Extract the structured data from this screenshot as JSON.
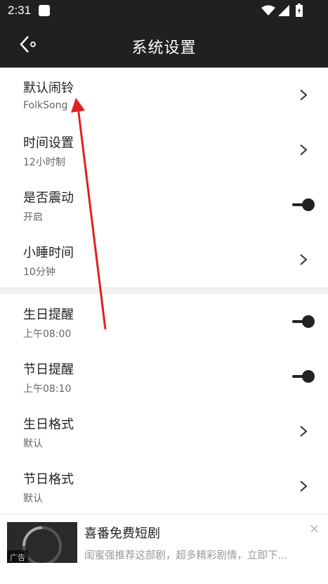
{
  "status_bar": {
    "time": "2:31"
  },
  "header": {
    "title": "系统设置"
  },
  "settings_group1": [
    {
      "label": "默认闹铃",
      "sub": "FolkSong",
      "control": "chevron"
    },
    {
      "label": "时间设置",
      "sub": "12小时制",
      "control": "chevron"
    },
    {
      "label": "是否震动",
      "sub": "开启",
      "control": "toggle"
    },
    {
      "label": "小睡时间",
      "sub": "10分钟",
      "control": "chevron"
    }
  ],
  "settings_group2": [
    {
      "label": "生日提醒",
      "sub": "上午08:00",
      "control": "toggle"
    },
    {
      "label": "节日提醒",
      "sub": "上午08:10",
      "control": "toggle"
    },
    {
      "label": "生日格式",
      "sub": "默认",
      "control": "chevron"
    },
    {
      "label": "节日格式",
      "sub": "默认",
      "control": "chevron"
    }
  ],
  "ad": {
    "badge": "广告",
    "title": "喜番免费短剧",
    "description": "闺蜜强推荐这部剧，超多精彩剧情，立即下..."
  },
  "colors": {
    "header_bg": "#202020",
    "annotation_arrow": "#e02020"
  }
}
